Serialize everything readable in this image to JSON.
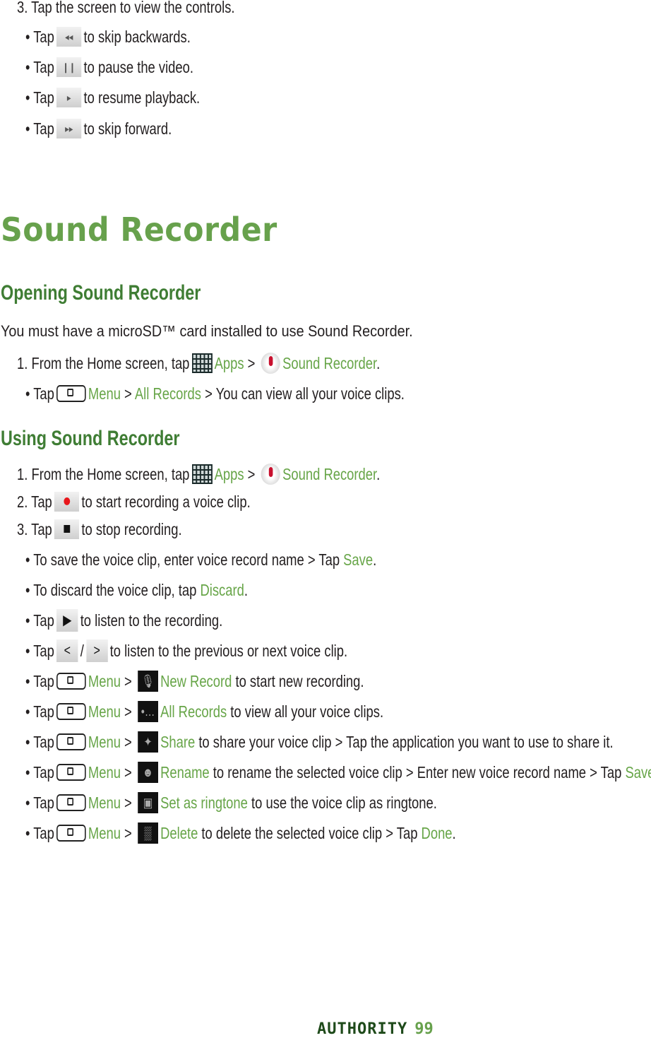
{
  "title": "Sound Recorder",
  "headings": [
    "Opening Sound Recorder",
    "Using Sound Recorder"
  ],
  "intro": "You must have a microSD™ card installed to use Sound Recorder.",
  "footer": {
    "brand": "AUTHORITY",
    "page": "99"
  },
  "colors": {
    "title": "#67a14c",
    "heading": "#3f7d34",
    "link": "#67a548",
    "brand": "#1e4a1a"
  },
  "lines": [
    {
      "segs": [
        {
          "text": "3. Tap the screen to view the controls."
        }
      ]
    },
    {
      "segs": [
        {
          "text": "•  Tap"
        },
        {
          "icon": "rewind"
        },
        {
          "text": "to skip backwards."
        }
      ]
    },
    {
      "segs": [
        {
          "text": "•  Tap"
        },
        {
          "icon": "pause"
        },
        {
          "text": "to pause the video."
        }
      ]
    },
    {
      "segs": [
        {
          "text": "•  Tap"
        },
        {
          "icon": "play-small"
        },
        {
          "text": "to resume playback."
        }
      ]
    },
    {
      "segs": [
        {
          "text": "•  Tap"
        },
        {
          "icon": "fast-forward"
        },
        {
          "text": "to skip forward."
        }
      ]
    },
    {
      "segs": [
        {
          "text": "1. From the Home screen, tap"
        },
        {
          "icon": "apps"
        },
        {
          "text": "Apps",
          "green": true
        },
        {
          "text": " > "
        },
        {
          "icon": "sound-recorder"
        },
        {
          "text": "Sound Recorder",
          "green": true
        },
        {
          "text": "."
        }
      ]
    },
    {
      "segs": [
        {
          "text": "• Tap"
        },
        {
          "icon": "menu-key"
        },
        {
          "text": "Menu",
          "green": true
        },
        {
          "text": " > "
        },
        {
          "text": "All Records",
          "green": true
        },
        {
          "text": " > You can view all your voice clips."
        }
      ]
    },
    {
      "segs": [
        {
          "text": "1. From the Home screen, tap"
        },
        {
          "icon": "apps"
        },
        {
          "text": "Apps",
          "green": true
        },
        {
          "text": " > "
        },
        {
          "icon": "sound-recorder"
        },
        {
          "text": "Sound Recorder",
          "green": true
        },
        {
          "text": "."
        }
      ]
    },
    {
      "segs": [
        {
          "text": "2. Tap"
        },
        {
          "icon": "record"
        },
        {
          "text": "to start recording a voice clip."
        }
      ]
    },
    {
      "segs": [
        {
          "text": "3. Tap"
        },
        {
          "icon": "stop"
        },
        {
          "text": "to stop recording."
        }
      ]
    },
    {
      "segs": [
        {
          "text": "• To save the voice clip, enter voice record name > Tap "
        },
        {
          "text": "Save",
          "green": true
        },
        {
          "text": "."
        }
      ]
    },
    {
      "segs": [
        {
          "text": "• To discard the voice clip, tap "
        },
        {
          "text": "Discard",
          "green": true
        },
        {
          "text": "."
        }
      ]
    },
    {
      "segs": [
        {
          "text": "• Tap"
        },
        {
          "icon": "play"
        },
        {
          "text": "to listen to the recording."
        }
      ]
    },
    {
      "segs": [
        {
          "text": "• Tap"
        },
        {
          "icon": "previous"
        },
        {
          "text": "/"
        },
        {
          "icon": "next"
        },
        {
          "text": "to listen to the previous or next voice clip."
        }
      ]
    },
    {
      "segs": [
        {
          "text": "• Tap"
        },
        {
          "icon": "menu-key"
        },
        {
          "text": "Menu",
          "green": true
        },
        {
          "text": " > "
        },
        {
          "icon": "new-record"
        },
        {
          "text": "New Record",
          "green": true
        },
        {
          "text": " to start new recording."
        }
      ]
    },
    {
      "segs": [
        {
          "text": "• Tap"
        },
        {
          "icon": "menu-key"
        },
        {
          "text": "Menu",
          "green": true
        },
        {
          "text": " > "
        },
        {
          "icon": "all-records"
        },
        {
          "text": "All Records",
          "green": true
        },
        {
          "text": " to view all your voice clips."
        }
      ]
    },
    {
      "segs": [
        {
          "text": "• Tap"
        },
        {
          "icon": "menu-key"
        },
        {
          "text": "Menu",
          "green": true
        },
        {
          "text": " > "
        },
        {
          "icon": "share"
        },
        {
          "text": "Share",
          "green": true
        },
        {
          "text": " to share your voice clip > Tap the application you want to use to share it."
        }
      ]
    },
    {
      "segs": [
        {
          "text": "• Tap"
        },
        {
          "icon": "menu-key"
        },
        {
          "text": "Menu",
          "green": true
        },
        {
          "text": " > "
        },
        {
          "icon": "rename"
        },
        {
          "text": "Rename",
          "green": true
        },
        {
          "text": " to rename the selected voice clip > Enter new voice record name > Tap "
        },
        {
          "text": "Save",
          "green": true
        },
        {
          "text": "."
        }
      ]
    },
    {
      "segs": [
        {
          "text": "• Tap"
        },
        {
          "icon": "menu-key"
        },
        {
          "text": "Menu",
          "green": true
        },
        {
          "text": " > "
        },
        {
          "icon": "ringtone"
        },
        {
          "text": "Set as ringtone",
          "green": true
        },
        {
          "text": " to use the voice clip as ringtone."
        }
      ]
    },
    {
      "segs": [
        {
          "text": "• Tap"
        },
        {
          "icon": "menu-key"
        },
        {
          "text": "Menu",
          "green": true
        },
        {
          "text": " > "
        },
        {
          "icon": "delete"
        },
        {
          "text": "Delete",
          "green": true
        },
        {
          "text": " to delete the selected voice clip > Tap "
        },
        {
          "text": "Done",
          "green": true
        },
        {
          "text": "."
        }
      ]
    }
  ]
}
